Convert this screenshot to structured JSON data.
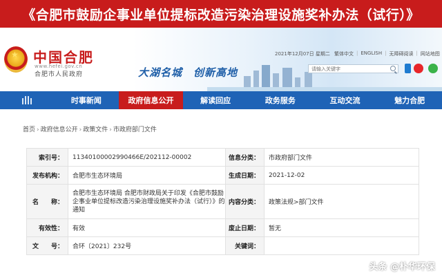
{
  "banner": {
    "title": "《合肥市鼓励企事业单位提标改造污染治理设施奖补办法（试行）》"
  },
  "header": {
    "site_name": "中国合肥",
    "site_url": "www.hefei.gov.cn",
    "site_sub": "合肥市人民政府",
    "slogan": "大湖名城　创新高地",
    "date_line": "2021年12月07日 星期二",
    "top_links": [
      "繁体中文",
      "ENGLISH",
      "无障碍阅读",
      "网站地图"
    ],
    "search_placeholder": "请输入关键字"
  },
  "nav": {
    "items": [
      {
        "label": "时事新闻"
      },
      {
        "label": "政府信息公开",
        "active": true
      },
      {
        "label": "解读回应"
      },
      {
        "label": "政务服务"
      },
      {
        "label": "互动交流"
      },
      {
        "label": "魅力合肥"
      }
    ]
  },
  "breadcrumb": [
    "首页",
    "政府信息公开",
    "政策文件",
    "市政府部门文件"
  ],
  "info": {
    "index_label": "索引号：",
    "index_value": "11340100002990466E/202112-00002",
    "category_label": "信息分类：",
    "category_value": "市政府部门文件",
    "publisher_label": "发布机构：",
    "publisher_value": "合肥市生态环境局",
    "date_label": "生成日期：",
    "date_value": "2021-12-02",
    "name_label": "名　　称：",
    "name_value": "合肥市生态环境局 合肥市财政局关于印发《合肥市鼓励企事业单位提标改造污染治理设施奖补办法（试行）》的通知",
    "content_label": "内容分类：",
    "content_value": "政策法规>部门文件",
    "validity_label": "有效性：",
    "validity_value": "有效",
    "expiry_label": "废止日期：",
    "expiry_value": "暂无",
    "docno_label": "文　　号：",
    "docno_value": "合环〔2021〕232号",
    "keywords_label": "关键词：",
    "keywords_value": ""
  },
  "watermark": "头条 @朴华环保",
  "colors": {
    "brand_red": "#c81c1c",
    "nav_blue": "#1f63b6"
  }
}
